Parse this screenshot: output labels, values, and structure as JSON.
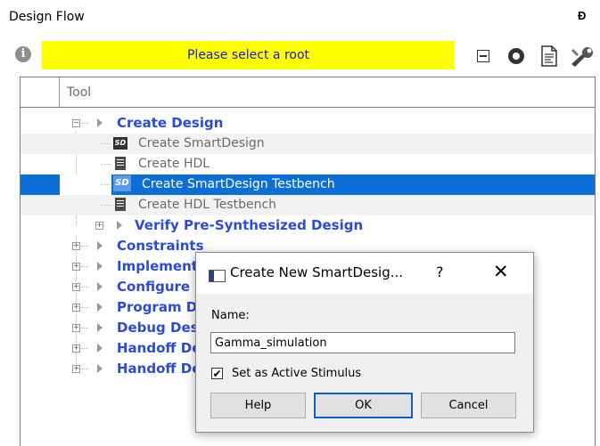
{
  "panel": {
    "title": "Design Flow",
    "pin_glyph": "Ɖ"
  },
  "toolbar": {
    "info_icon": "info-icon",
    "banner_text": "Please select a root",
    "banner_color": "#ffff00",
    "icons": [
      "collapse-all-icon",
      "stop-icon",
      "report-icon",
      "settings-wrench-icon"
    ]
  },
  "tree": {
    "column_header": "Tool",
    "rows": [
      {
        "label": "Create Design",
        "kind": "category",
        "expanded": true
      },
      {
        "label": "Create SmartDesign",
        "kind": "item",
        "icon": "smartdesign-icon"
      },
      {
        "label": "Create HDL",
        "kind": "item",
        "icon": "hdl-file-icon"
      },
      {
        "label": "Create SmartDesign Testbench",
        "kind": "item",
        "icon": "smartdesign-testbench-icon",
        "selected": true
      },
      {
        "label": "Create HDL Testbench",
        "kind": "item",
        "icon": "hdl-file-icon"
      },
      {
        "label": "Verify Pre-Synthesized Design",
        "kind": "category",
        "expanded": false
      },
      {
        "label": "Constraints",
        "kind": "category",
        "expanded": false
      },
      {
        "label": "Implement",
        "kind": "category",
        "expanded": false
      },
      {
        "label": "Configure I",
        "kind": "category",
        "expanded": false
      },
      {
        "label": "Program D",
        "kind": "category",
        "expanded": false
      },
      {
        "label": "Debug Des",
        "kind": "category",
        "expanded": false
      },
      {
        "label": "Handoff De",
        "kind": "category",
        "expanded": false
      },
      {
        "label": "Handoff De",
        "kind": "category",
        "expanded": false
      }
    ],
    "selection_color": "#0d6fd6"
  },
  "dialog": {
    "title": "Create New SmartDesig...",
    "help_glyph": "?",
    "close_glyph": "✕",
    "name_label": "Name:",
    "name_value": "Gamma_simulation",
    "checkbox_checked": true,
    "checkbox_mark": "✔",
    "checkbox_label": "Set as Active Stimulus",
    "buttons": {
      "help": "Help",
      "ok": "OK",
      "cancel": "Cancel"
    }
  }
}
